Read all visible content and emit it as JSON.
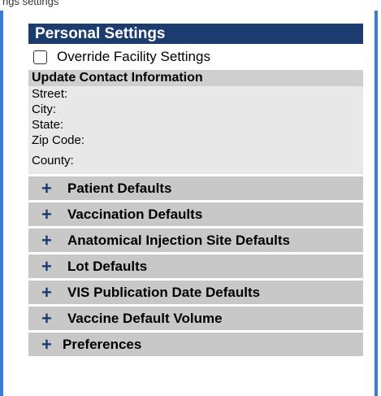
{
  "top_caption": "ngs settings",
  "header": {
    "title": "Personal Settings"
  },
  "override": {
    "label": "Override Facility Settings",
    "checked": false
  },
  "contact": {
    "title": "Update Contact Information",
    "fields": [
      "Street:",
      "City:",
      "State:",
      "Zip Code:",
      "County:"
    ]
  },
  "sections": [
    {
      "label": "Patient Defaults",
      "icon": "plus-icon"
    },
    {
      "label": "Vaccination Defaults",
      "icon": "plus-icon"
    },
    {
      "label": "Anatomical Injection Site Defaults",
      "icon": "plus-icon"
    },
    {
      "label": "Lot Defaults",
      "icon": "plus-icon"
    },
    {
      "label": "VIS Publication Date Defaults",
      "icon": "plus-icon"
    },
    {
      "label": "Vaccine Default Volume",
      "icon": "plus-icon"
    },
    {
      "label": "Preferences",
      "icon": "plus-icon"
    }
  ],
  "colors": {
    "header": "#1c3b6f",
    "border": "#3a7bd5",
    "section": "#c8c8c8"
  }
}
